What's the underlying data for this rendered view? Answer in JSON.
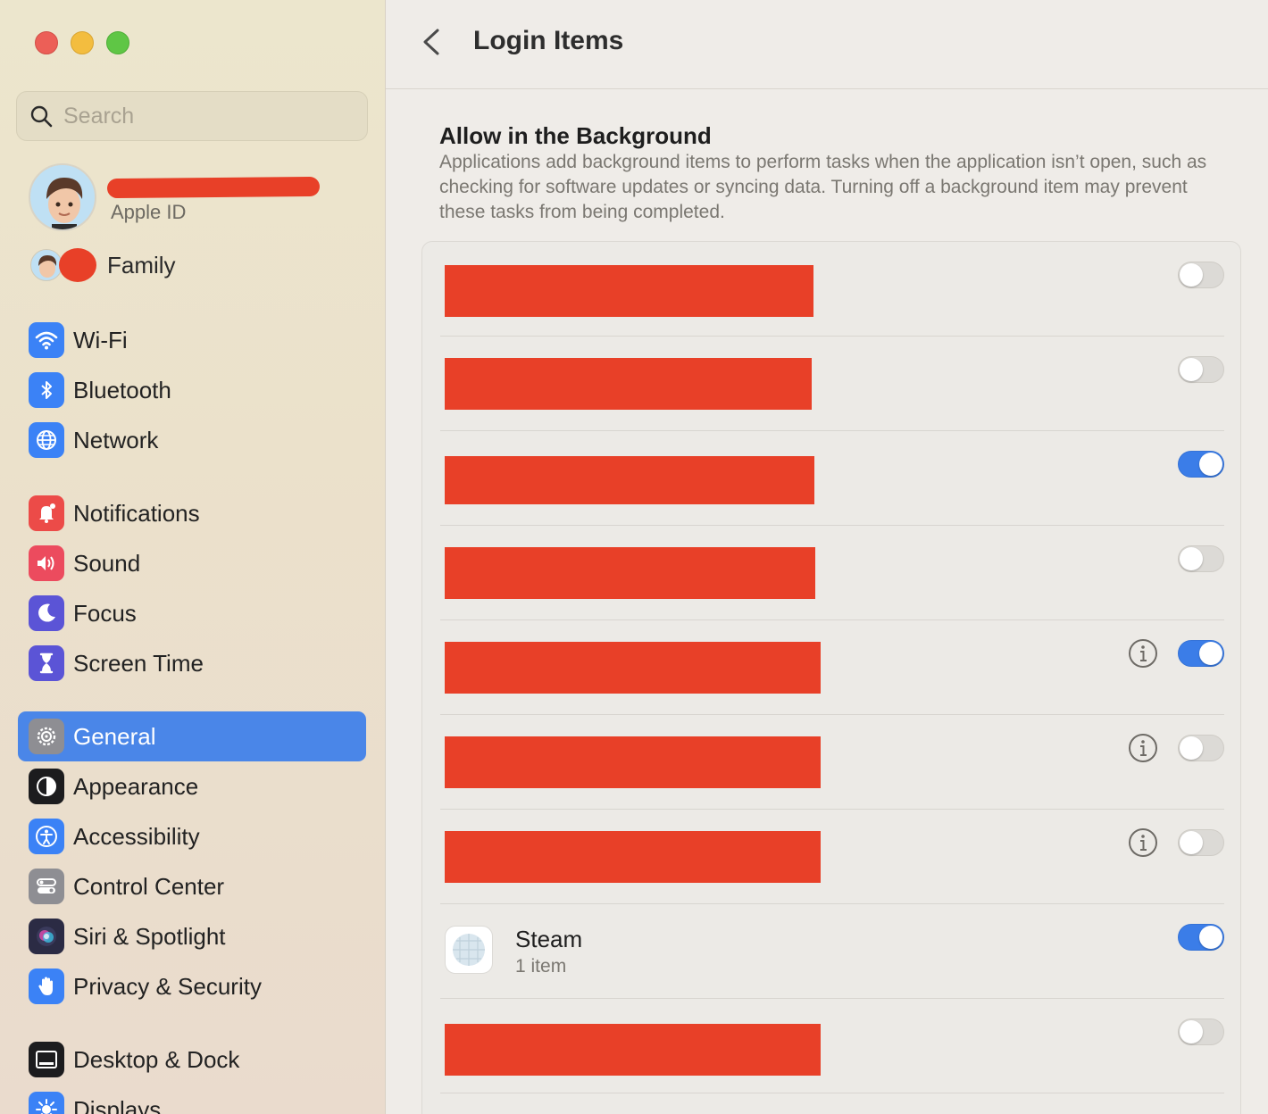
{
  "sidebar": {
    "search_placeholder": "Search",
    "apple_id_label": "Apple ID",
    "family_label": "Family",
    "items": [
      {
        "label": "Wi-Fi",
        "icon": "wifi-icon",
        "color": "#3b82f6"
      },
      {
        "label": "Bluetooth",
        "icon": "bluetooth-icon",
        "color": "#3b82f6"
      },
      {
        "label": "Network",
        "icon": "globe-icon",
        "color": "#3b82f6"
      },
      {
        "label": "Notifications",
        "icon": "bell-icon",
        "color": "#ec4b48"
      },
      {
        "label": "Sound",
        "icon": "speaker-icon",
        "color": "#ec4b5e"
      },
      {
        "label": "Focus",
        "icon": "moon-icon",
        "color": "#5b54d6"
      },
      {
        "label": "Screen Time",
        "icon": "hourglass-icon",
        "color": "#5b54d6"
      },
      {
        "label": "General",
        "icon": "gear-icon",
        "color": "#8e8e93",
        "selected": true
      },
      {
        "label": "Appearance",
        "icon": "appearance-icon",
        "color": "#1c1c1e"
      },
      {
        "label": "Accessibility",
        "icon": "accessibility-icon",
        "color": "#3b82f6"
      },
      {
        "label": "Control Center",
        "icon": "control-center-icon",
        "color": "#8e8e93"
      },
      {
        "label": "Siri & Spotlight",
        "icon": "siri-icon",
        "color": "#2b2b44"
      },
      {
        "label": "Privacy & Security",
        "icon": "hand-icon",
        "color": "#3b82f6"
      },
      {
        "label": "Desktop & Dock",
        "icon": "dock-icon",
        "color": "#1c1c1e"
      },
      {
        "label": "Displays",
        "icon": "sun-icon",
        "color": "#3b82f6"
      }
    ]
  },
  "main": {
    "title": "Login Items",
    "section_title": "Allow in the Background",
    "section_description": "Applications add background items to perform tasks when the application isn’t open, such as checking for software updates or syncing data. Turning off a background item may prevent these tasks from being completed.",
    "rows": [
      {
        "redacted": true,
        "toggle_on": false,
        "info": false
      },
      {
        "redacted": true,
        "toggle_on": false,
        "info": false
      },
      {
        "redacted": true,
        "toggle_on": true,
        "info": false
      },
      {
        "redacted": true,
        "toggle_on": false,
        "info": false
      },
      {
        "redacted": true,
        "toggle_on": true,
        "info": true
      },
      {
        "redacted": true,
        "toggle_on": false,
        "info": true
      },
      {
        "redacted": true,
        "toggle_on": false,
        "info": true
      },
      {
        "redacted": false,
        "name": "Steam",
        "subtitle": "1 item",
        "toggle_on": true,
        "info": false
      },
      {
        "redacted": true,
        "toggle_on": false,
        "info": false
      }
    ]
  },
  "colors": {
    "accent": "#4a86e8",
    "toggle_on": "#3b7de8",
    "redaction": "#e84028"
  }
}
